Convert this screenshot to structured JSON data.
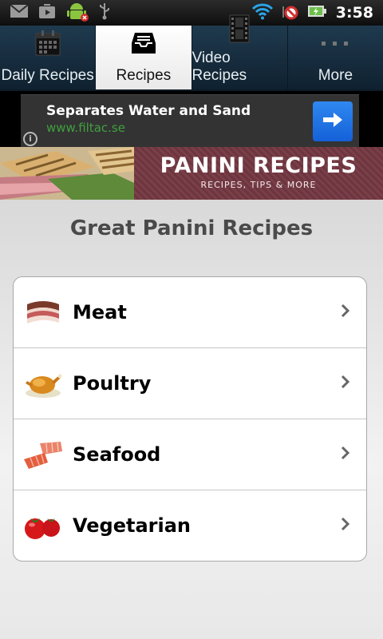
{
  "status_bar": {
    "time": "3:58",
    "icons": [
      "gmail-icon",
      "play-store-icon",
      "android-debug-icon",
      "usb-icon",
      "wifi-icon",
      "no-signal-icon",
      "battery-charging-icon"
    ]
  },
  "tabs": [
    {
      "label": "Daily Recipes",
      "icon": "calendar-icon",
      "active": false
    },
    {
      "label": "Recipes",
      "icon": "inbox-tray-icon",
      "active": true
    },
    {
      "label": "Video Recipes",
      "icon": "film-strip-icon",
      "active": false
    },
    {
      "label": "More",
      "icon": "more-dots-icon",
      "active": false
    }
  ],
  "ad": {
    "title": "Separates Water and Sand",
    "url": "www.filtac.se",
    "info": "i",
    "button_icon": "arrow-right-icon"
  },
  "banner": {
    "title": "PANINI RECIPES",
    "subtitle": "RECIPES, TIPS & MORE"
  },
  "page": {
    "title": "Great Panini Recipes"
  },
  "categories": [
    {
      "label": "Meat",
      "icon": "bacon-icon"
    },
    {
      "label": "Poultry",
      "icon": "roast-chicken-icon"
    },
    {
      "label": "Seafood",
      "icon": "salmon-fillet-icon"
    },
    {
      "label": "Vegetarian",
      "icon": "tomatoes-icon"
    }
  ],
  "colors": {
    "tabbar": "#1f3a4e",
    "active_tab": "#ffffff",
    "ad_url": "#3fa03f",
    "ad_button": "#1d6ee0",
    "banner": "#7a3f47"
  }
}
